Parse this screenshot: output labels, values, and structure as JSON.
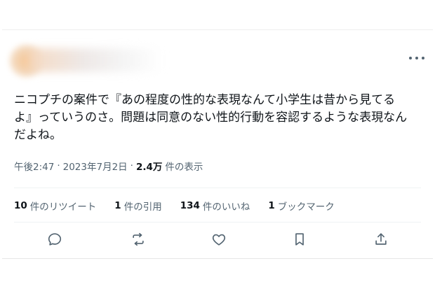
{
  "tweet": {
    "text_lines": [
      "ニコプチの案件で『あの程度の性的な表現なんて小学生は昔から見てる",
      "よ』っていうのさ。問題は同意のない性的行動を容認するような表現なん",
      "だよね。"
    ],
    "time": "午後2:47",
    "separator": "·",
    "date": "2023年7月2日",
    "views_count": "2.4万",
    "views_label": "件の表示"
  },
  "stats": {
    "retweets": {
      "count": "10",
      "label": "件のリツイート"
    },
    "quotes": {
      "count": "1",
      "label": "件の引用"
    },
    "likes": {
      "count": "134",
      "label": "件のいいね"
    },
    "bookmarks": {
      "count": "1",
      "label": "ブックマーク"
    }
  },
  "icons": {
    "more": "more-horizontal-icon",
    "reply": "reply-icon",
    "retweet": "retweet-icon",
    "like": "heart-icon",
    "bookmark": "bookmark-icon",
    "share": "share-icon"
  },
  "colors": {
    "text": "#0f1419",
    "secondary": "#536471",
    "divider": "#eff3f4"
  }
}
